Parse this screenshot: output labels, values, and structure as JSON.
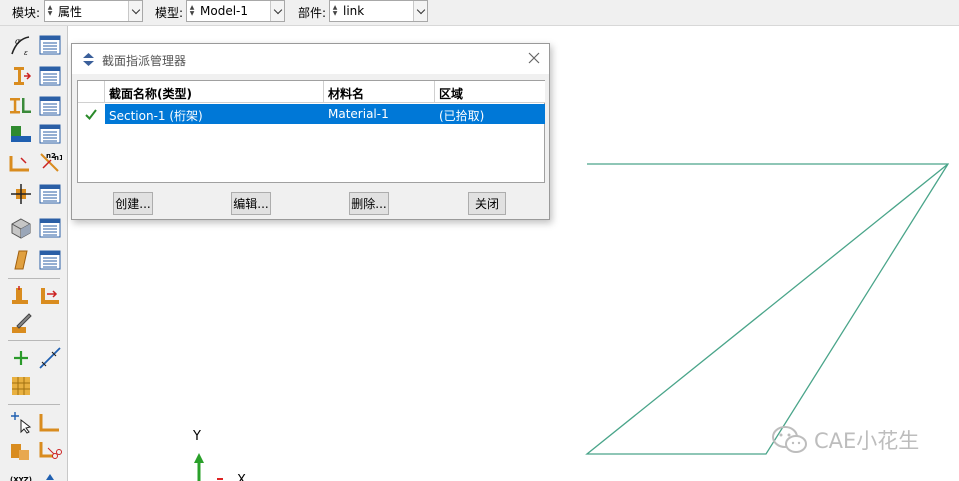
{
  "toolbar": {
    "module_label": "模块:",
    "module_value": "属性",
    "model_label": "模型:",
    "model_value": "Model-1",
    "part_label": "部件:",
    "part_value": "link"
  },
  "dialog": {
    "title": "截面指派管理器",
    "columns": [
      "截面名称(类型)",
      "材料名",
      "区域"
    ],
    "rows": [
      {
        "section": "Section-1 (桁架)",
        "material": "Material-1",
        "region": "(已拾取)",
        "checked": true
      }
    ],
    "buttons": {
      "create": "创建...",
      "edit": "编辑...",
      "delete": "删除...",
      "close": "关闭"
    }
  },
  "triad": {
    "y_label": "Y",
    "x_label": "X"
  },
  "watermark": {
    "text": "CAE小花生"
  },
  "colors": {
    "selection": "#0078d7",
    "model_line": "#4aa58a",
    "check": "#2a8a2a"
  }
}
